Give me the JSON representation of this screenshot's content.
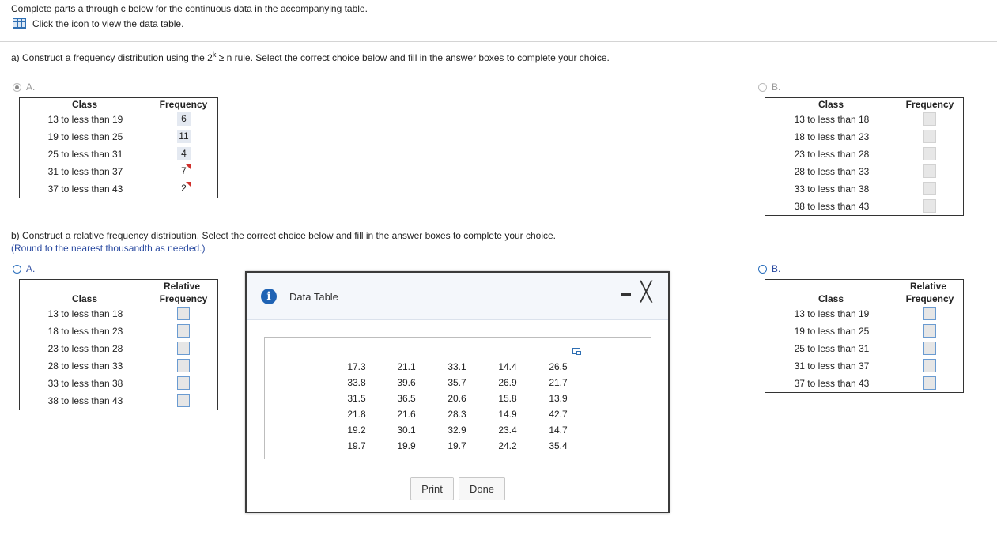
{
  "intro": {
    "text": "Complete parts a through c below for the continuous data in the accompanying table.",
    "link_text": "Click the icon to view the data table."
  },
  "part_a": {
    "text_before": "a) Construct a frequency distribution using the 2",
    "sup": "k",
    "text_after": " ≥ n rule. Select the correct choice below and fill in the answer boxes to complete your choice.",
    "option_a_label": "A.",
    "option_b_label": "B.",
    "class_header": "Class",
    "freq_header": "Frequency",
    "option_a_rows": [
      {
        "class": "13 to less than 19",
        "frequency": "6"
      },
      {
        "class": "19 to less than 25",
        "frequency": "11"
      },
      {
        "class": "25 to less than 31",
        "frequency": "4"
      },
      {
        "class": "31 to less than 37",
        "frequency": "7"
      },
      {
        "class": "37 to less than 43",
        "frequency": "2"
      }
    ],
    "option_b_rows": [
      {
        "class": "13 to less than 18"
      },
      {
        "class": "18 to less than 23"
      },
      {
        "class": "23 to less than 28"
      },
      {
        "class": "28 to less than 33"
      },
      {
        "class": "33 to less than 38"
      },
      {
        "class": "38 to less than 43"
      }
    ]
  },
  "part_b": {
    "text": "b) Construct a relative frequency distribution. Select the correct choice below and fill in the answer boxes to complete your choice.",
    "round_note": "(Round to the nearest thousandth as needed.)",
    "option_a_label": "A.",
    "option_b_label": "B.",
    "class_header": "Class",
    "rel_header_1": "Relative",
    "rel_header_2": "Frequency",
    "option_a_rows": [
      {
        "class": "13 to less than 18"
      },
      {
        "class": "18 to less than 23"
      },
      {
        "class": "23 to less than 28"
      },
      {
        "class": "28 to less than 33"
      },
      {
        "class": "33 to less than 38"
      },
      {
        "class": "38 to less than 43"
      }
    ],
    "option_b_rows": [
      {
        "class": "13 to less than 19"
      },
      {
        "class": "19 to less than 25"
      },
      {
        "class": "25 to less than 31"
      },
      {
        "class": "31 to less than 37"
      },
      {
        "class": "37 to less than 43"
      }
    ]
  },
  "modal": {
    "title": "Data Table",
    "close_glyph": "╳",
    "info_glyph": "i",
    "data_rows": [
      [
        "17.3",
        "21.1",
        "33.1",
        "14.4",
        "26.5"
      ],
      [
        "33.8",
        "39.6",
        "35.7",
        "26.9",
        "21.7"
      ],
      [
        "31.5",
        "36.5",
        "20.6",
        "15.8",
        "13.9"
      ],
      [
        "21.8",
        "21.6",
        "28.3",
        "14.9",
        "42.7"
      ],
      [
        "19.2",
        "30.1",
        "32.9",
        "23.4",
        "14.7"
      ],
      [
        "19.7",
        "19.9",
        "19.7",
        "24.2",
        "35.4"
      ]
    ],
    "print_label": "Print",
    "done_label": "Done"
  }
}
